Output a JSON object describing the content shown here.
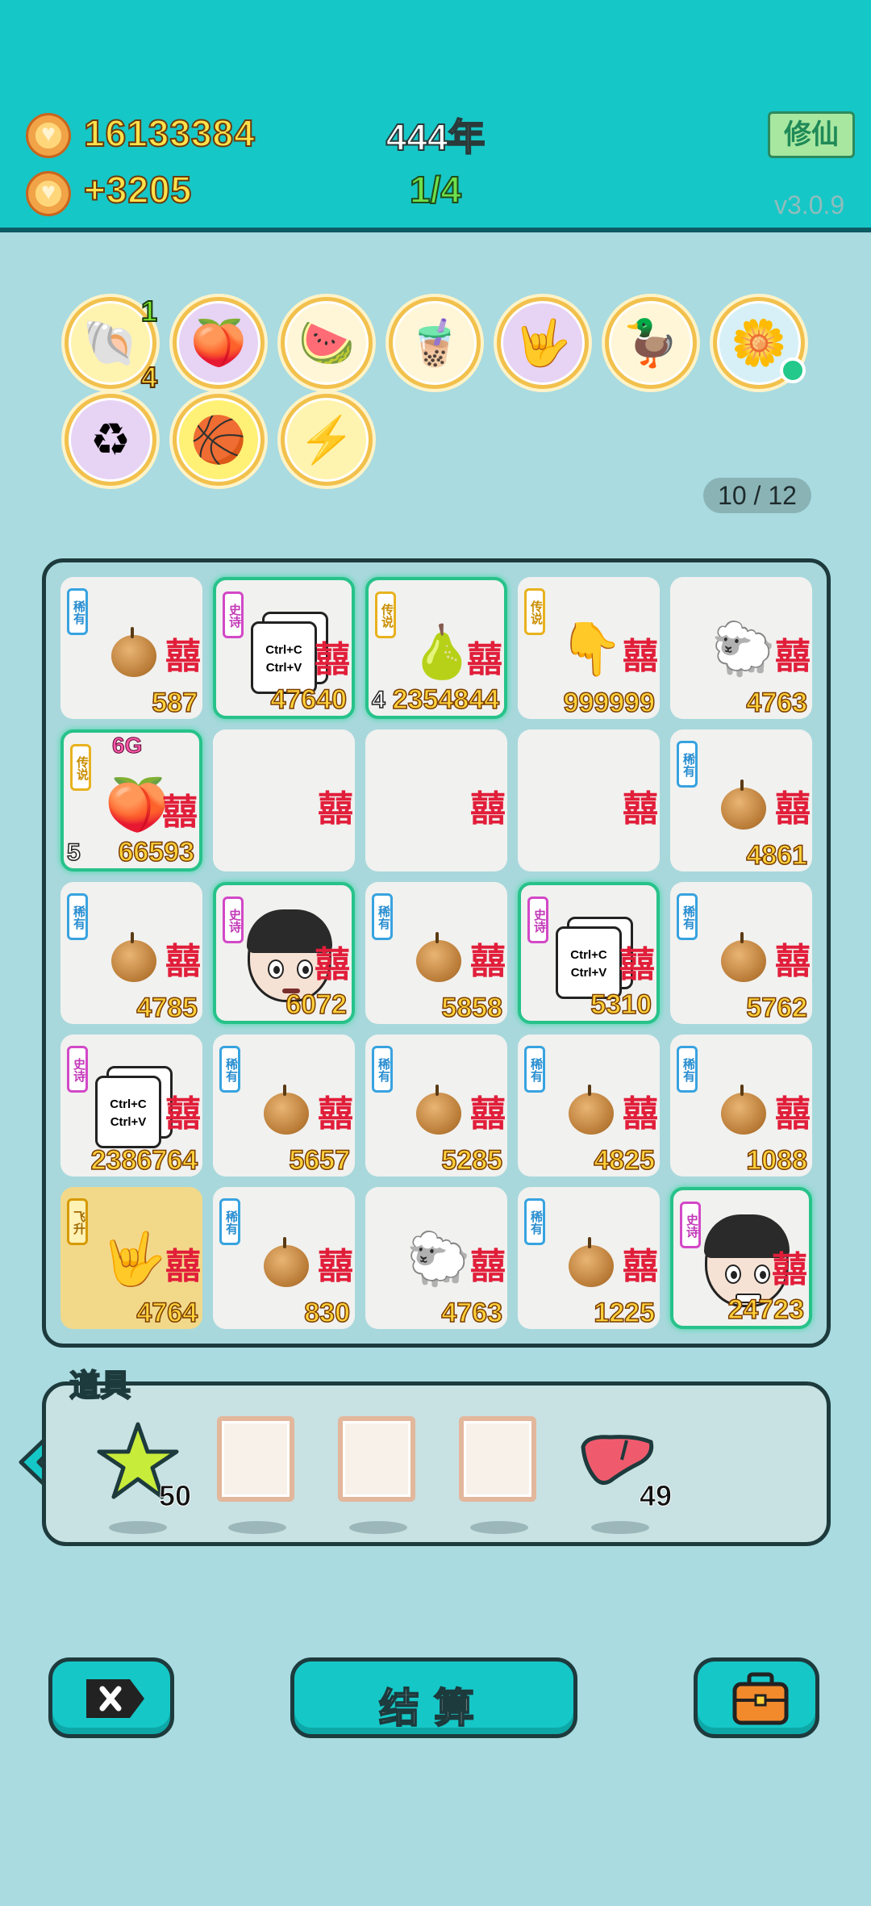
{
  "header": {
    "gold": "16133384",
    "income": "+3205",
    "year": "444年",
    "wave": "1/4",
    "cultivate_label": "修仙",
    "version": "v3.0.9"
  },
  "relics": {
    "items": [
      {
        "icon": "shell-icon",
        "badge_top": "1",
        "badge_bottom": "4"
      },
      {
        "icon": "pirate-peaches-icon"
      },
      {
        "icon": "fruit-platter-icon"
      },
      {
        "icon": "bubble-tea-icon"
      },
      {
        "icon": "rock-hand-icon"
      },
      {
        "icon": "rice-cooker-duck-icon"
      },
      {
        "icon": "potted-flower-icon"
      },
      {
        "icon": "recycle-icon"
      },
      {
        "icon": "basketballs-icon"
      },
      {
        "icon": "lightning-icon"
      }
    ],
    "counter": "10 / 12"
  },
  "board": {
    "xi_char": "囍",
    "cells": [
      {
        "rarity": "稀有",
        "tier": "rare",
        "item": "nut",
        "value": "587"
      },
      {
        "rarity": "史诗",
        "tier": "epic",
        "item": "copy-card",
        "value": "47640",
        "glow": true
      },
      {
        "rarity": "传说",
        "tier": "legend",
        "item": "pear",
        "value": "2354844",
        "level": "4",
        "glow": true
      },
      {
        "rarity": "传说",
        "tier": "legend",
        "item": "pointing-hand",
        "value": "999999"
      },
      {
        "rarity": "",
        "tier": "",
        "item": "sheep",
        "value": "4763"
      },
      {
        "rarity": "传说",
        "tier": "legend",
        "item": "crowned-peaches",
        "value": "66593",
        "level": "5",
        "tag": "6G",
        "glow": true
      },
      {
        "rarity": "",
        "tier": "",
        "item": "empty",
        "value": ""
      },
      {
        "rarity": "",
        "tier": "",
        "item": "empty",
        "value": ""
      },
      {
        "rarity": "",
        "tier": "",
        "item": "empty",
        "value": ""
      },
      {
        "rarity": "稀有",
        "tier": "rare",
        "item": "nut",
        "value": "4861"
      },
      {
        "rarity": "稀有",
        "tier": "rare",
        "item": "nut",
        "value": "4785"
      },
      {
        "rarity": "史诗",
        "tier": "epic",
        "item": "face",
        "value": "6072",
        "glow": true
      },
      {
        "rarity": "稀有",
        "tier": "rare",
        "item": "nut",
        "value": "5858"
      },
      {
        "rarity": "史诗",
        "tier": "epic",
        "item": "copy-card",
        "value": "5310",
        "glow": true
      },
      {
        "rarity": "稀有",
        "tier": "rare",
        "item": "nut",
        "value": "5762"
      },
      {
        "rarity": "史诗",
        "tier": "epic",
        "item": "copy-card",
        "value": "2386764"
      },
      {
        "rarity": "稀有",
        "tier": "rare",
        "item": "nut",
        "value": "5657"
      },
      {
        "rarity": "稀有",
        "tier": "rare",
        "item": "nut",
        "value": "5285"
      },
      {
        "rarity": "稀有",
        "tier": "rare",
        "item": "nut",
        "value": "4825"
      },
      {
        "rarity": "稀有",
        "tier": "rare",
        "item": "nut",
        "value": "1088"
      },
      {
        "rarity": "飞升",
        "tier": "ascend",
        "item": "rock-hand",
        "value": "4764",
        "gold": true
      },
      {
        "rarity": "稀有",
        "tier": "rare",
        "item": "nut",
        "value": "830"
      },
      {
        "rarity": "",
        "tier": "",
        "item": "sheep",
        "value": "4763"
      },
      {
        "rarity": "稀有",
        "tier": "rare",
        "item": "nut",
        "value": "1225"
      },
      {
        "rarity": "史诗",
        "tier": "epic",
        "item": "face-smile",
        "value": "24723",
        "glow": true
      }
    ],
    "copy_text_1": "Ctrl+C",
    "copy_text_2": "Ctrl+V"
  },
  "props": {
    "title": "道具",
    "star_count": "50",
    "liver_count": "49"
  },
  "actions": {
    "settle_label": "结算"
  },
  "colors": {
    "header_bg": "#16c7c7",
    "page_bg": "#a9dbe0",
    "gold_text": "#ffe14a",
    "green_text": "#6de04a",
    "xi_red": "#e11e3a"
  }
}
